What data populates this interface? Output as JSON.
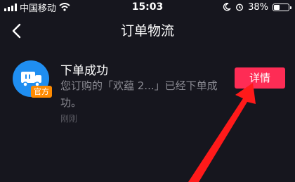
{
  "status_bar": {
    "carrier": "中国移动",
    "time": "15:03",
    "battery": "38%",
    "battery_level": 0.38
  },
  "nav": {
    "title": "订单物流",
    "back_icon": "chevron-left-icon"
  },
  "message": {
    "title": "下单成功",
    "body": "您订购的「欢蕴 2...」已经下单成功。",
    "time": "刚刚",
    "badge": "官方",
    "detail_button": "详情"
  },
  "colors": {
    "background": "#16161e",
    "accent": "#fe2c55",
    "avatar": "#1f8ef1",
    "badge": "#ff8a00",
    "annotation_arrow": "#ff1a1a"
  }
}
